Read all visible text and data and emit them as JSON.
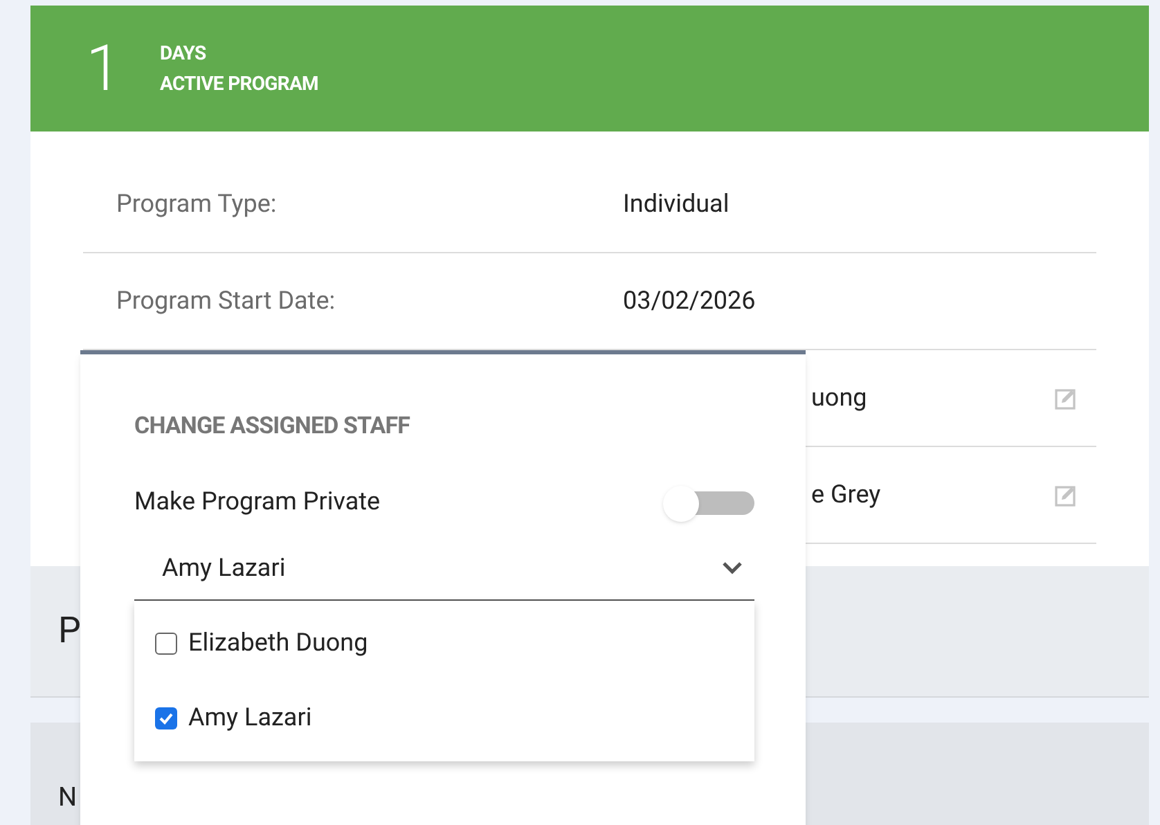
{
  "summary": {
    "count": "1",
    "unit": "DAYS",
    "caption": "ACTIVE PROGRAM"
  },
  "details": [
    {
      "label": "Program Type:",
      "value": "Individual",
      "editable": false
    },
    {
      "label": "Program Start Date:",
      "value": "03/02/2026",
      "editable": false
    },
    {
      "value": "uong",
      "editable": true
    },
    {
      "value": "e Grey",
      "editable": true
    }
  ],
  "section_heading": "P",
  "table_header": "N",
  "popover": {
    "title": "CHANGE ASSIGNED STAFF",
    "private_label": "Make Program Private",
    "private_on": false,
    "select_value": "Amy Lazari",
    "options": [
      {
        "label": "Elizabeth Duong",
        "checked": false
      },
      {
        "label": "Amy Lazari",
        "checked": true
      }
    ]
  }
}
